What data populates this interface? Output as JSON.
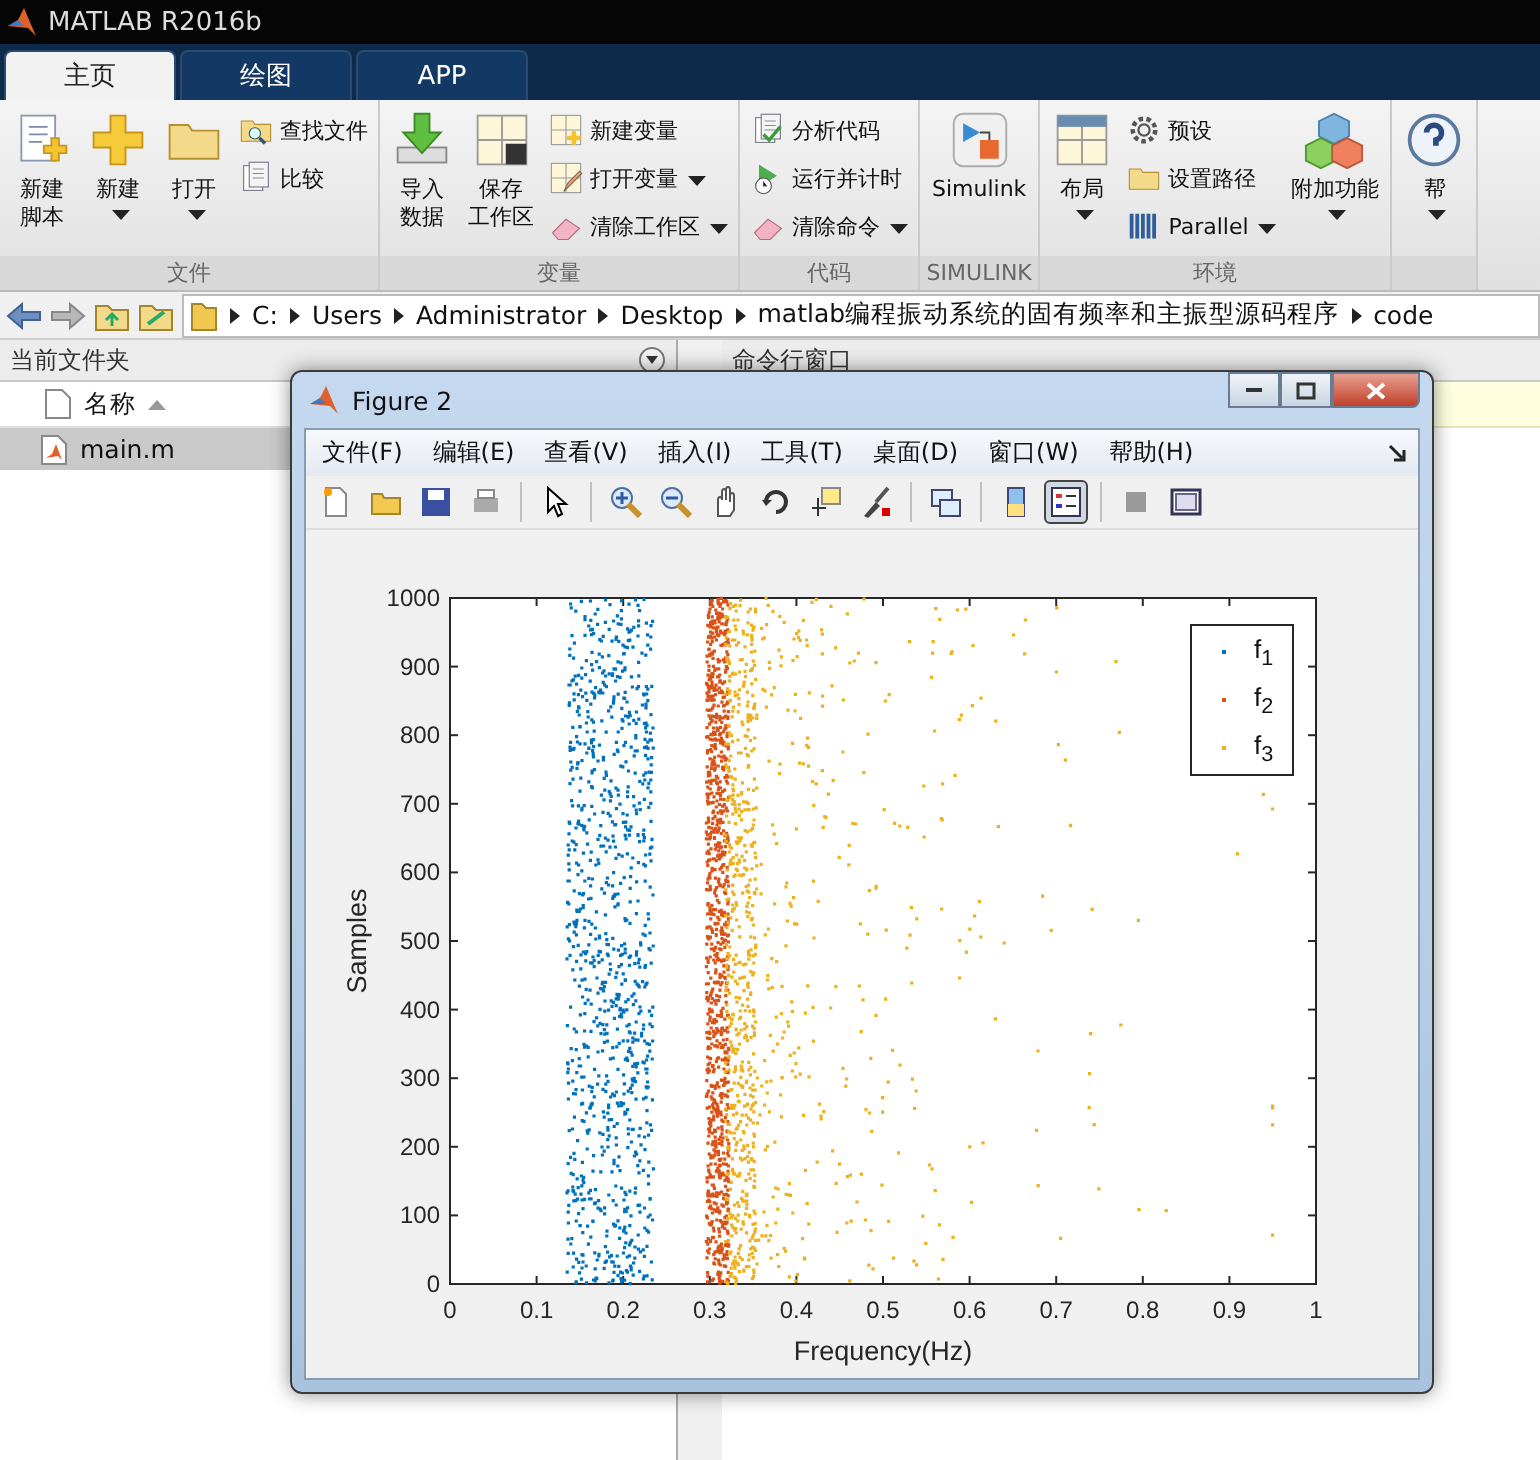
{
  "window": {
    "title": "MATLAB R2016b"
  },
  "tabs": [
    {
      "label": "主页",
      "selected": true
    },
    {
      "label": "绘图",
      "selected": false
    },
    {
      "label": "APP",
      "selected": false
    }
  ],
  "ribbon": {
    "groups": [
      {
        "label": "文件",
        "columns": [
          {
            "kind": "large",
            "lines": [
              "新建",
              "脚本"
            ],
            "dropdown": false
          },
          {
            "kind": "large",
            "lines": [
              "新建"
            ],
            "dropdown": true
          },
          {
            "kind": "large",
            "lines": [
              "打开"
            ],
            "dropdown": true
          },
          {
            "kind": "stack",
            "items": [
              {
                "label": "查找文件",
                "dropdown": false
              },
              {
                "label": "比较",
                "dropdown": false
              }
            ]
          }
        ]
      },
      {
        "label": "变量",
        "columns": [
          {
            "kind": "large",
            "lines": [
              "导入",
              "数据"
            ],
            "dropdown": false
          },
          {
            "kind": "large",
            "lines": [
              "保存",
              "工作区"
            ],
            "dropdown": false
          },
          {
            "kind": "stack",
            "items": [
              {
                "label": "新建变量",
                "dropdown": false
              },
              {
                "label": "打开变量",
                "dropdown": true
              },
              {
                "label": "清除工作区",
                "dropdown": true
              }
            ]
          }
        ]
      },
      {
        "label": "代码",
        "columns": [
          {
            "kind": "stack",
            "items": [
              {
                "label": "分析代码",
                "dropdown": false
              },
              {
                "label": "运行并计时",
                "dropdown": false
              },
              {
                "label": "清除命令",
                "dropdown": true
              }
            ]
          }
        ]
      },
      {
        "label": "SIMULINK",
        "columns": [
          {
            "kind": "large",
            "lines": [
              "Simulink"
            ],
            "dropdown": false
          }
        ]
      },
      {
        "label": "环境",
        "columns": [
          {
            "kind": "large",
            "lines": [
              "布局"
            ],
            "dropdown": true
          },
          {
            "kind": "stack",
            "items": [
              {
                "label": "预设",
                "dropdown": false
              },
              {
                "label": "设置路径",
                "dropdown": false
              },
              {
                "label": "Parallel",
                "dropdown": true
              }
            ]
          },
          {
            "kind": "large",
            "lines": [
              "附加功能"
            ],
            "dropdown": true
          }
        ]
      },
      {
        "columns": [
          {
            "kind": "large",
            "lines": [
              "帮"
            ],
            "dropdown": true
          }
        ]
      }
    ]
  },
  "path_bar": {
    "crumbs": [
      "C:",
      "Users",
      "Administrator",
      "Desktop",
      "matlab编程振动系统的固有频率和主振型源码程序",
      "code"
    ]
  },
  "file_panel": {
    "title": "当前文件夹",
    "column": "名称",
    "files": [
      {
        "name": "main.m",
        "selected": true
      }
    ]
  },
  "command_panel": {
    "title": "命令行窗口"
  },
  "figure": {
    "title": "Figure 2",
    "menus": [
      "文件(F)",
      "编辑(E)",
      "查看(V)",
      "插入(I)",
      "工具(T)",
      "桌面(D)",
      "窗口(W)",
      "帮助(H)"
    ],
    "toolbar": [
      [
        {
          "selected": false
        },
        {
          "selected": false
        },
        {
          "selected": false
        },
        {
          "selected": false
        }
      ],
      [
        {
          "selected": false
        }
      ],
      [
        {
          "selected": false
        },
        {
          "selected": false
        },
        {
          "selected": false
        },
        {
          "selected": false
        },
        {
          "selected": false
        },
        {
          "selected": false
        }
      ],
      [
        {
          "selected": false
        }
      ],
      [
        {
          "selected": false
        },
        {
          "selected": true
        }
      ],
      [
        {
          "selected": false
        },
        {
          "selected": false
        }
      ]
    ],
    "plot": {
      "xlabel": "Frequency(Hz)",
      "ylabel": "Samples",
      "xtick_labels": [
        "0",
        "0.1",
        "0.2",
        "0.3",
        "0.4",
        "0.5",
        "0.6",
        "0.7",
        "0.8",
        "0.9",
        "1"
      ],
      "ytick_labels": [
        "1000",
        "900",
        "800",
        "700",
        "600",
        "500",
        "400",
        "300",
        "200",
        "100",
        "0"
      ],
      "legend": [
        {
          "label": "f$_{1}$",
          "color": "#0072bd"
        },
        {
          "label": "f$_{2}$",
          "color": "#d95319"
        },
        {
          "label": "f$_{3}$",
          "color": "#edb120"
        }
      ]
    }
  }
}
